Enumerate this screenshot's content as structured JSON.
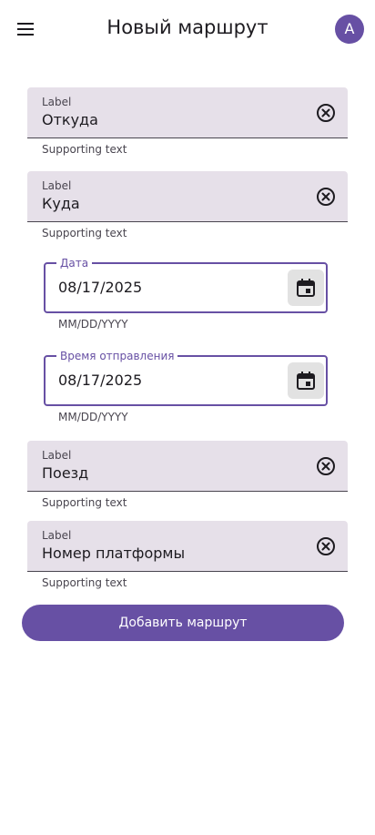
{
  "header": {
    "title": "Новый маршрут",
    "avatar_letter": "A"
  },
  "fields": {
    "from": {
      "label": "Label",
      "value": "Откуда",
      "supporting": "Supporting text"
    },
    "to": {
      "label": "Label",
      "value": "Куда",
      "supporting": "Supporting text"
    },
    "date": {
      "label": "Дата",
      "value": "08/17/2025",
      "supporting": "MM/DD/YYYY"
    },
    "departure": {
      "label": "Время отправления",
      "value": "08/17/2025",
      "supporting": "MM/DD/YYYY"
    },
    "train": {
      "label": "Label",
      "value": "Поезд",
      "supporting": "Supporting text"
    },
    "platform": {
      "label": "Label",
      "value": "Номер платформы",
      "supporting": "Supporting text"
    }
  },
  "actions": {
    "add_route": "Добавить маршрут"
  },
  "colors": {
    "primary": "#6750a4",
    "surface_container": "#e6e0e9",
    "on_surface": "#1d1b20",
    "on_surface_variant": "#49454f"
  },
  "icons": {
    "menu": "menu-icon",
    "clear": "cancel-circle-icon",
    "calendar": "calendar-icon"
  }
}
